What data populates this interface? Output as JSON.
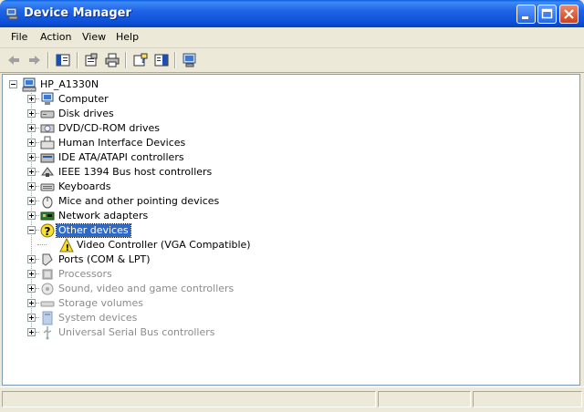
{
  "window": {
    "title": "Device Manager"
  },
  "menu": [
    "File",
    "Action",
    "View",
    "Help"
  ],
  "toolbar": [
    "back-icon",
    "forward-icon",
    "up-icon",
    "properties-icon",
    "print-icon",
    "help-icon",
    "console-tree-icon",
    "scan-hardware-icon"
  ],
  "tree": {
    "root": "HP_A1330N",
    "categories": [
      {
        "label": "Computer",
        "icon": "computer-icon",
        "expanded": false,
        "dim": false
      },
      {
        "label": "Disk drives",
        "icon": "disk-drive-icon",
        "expanded": false,
        "dim": false
      },
      {
        "label": "DVD/CD-ROM drives",
        "icon": "cdrom-icon",
        "expanded": false,
        "dim": false
      },
      {
        "label": "Human Interface Devices",
        "icon": "hid-icon",
        "expanded": false,
        "dim": false
      },
      {
        "label": "IDE ATA/ATAPI controllers",
        "icon": "ide-controller-icon",
        "expanded": false,
        "dim": false
      },
      {
        "label": "IEEE 1394 Bus host controllers",
        "icon": "ieee1394-icon",
        "expanded": false,
        "dim": false
      },
      {
        "label": "Keyboards",
        "icon": "keyboard-icon",
        "expanded": false,
        "dim": false
      },
      {
        "label": "Mice and other pointing devices",
        "icon": "mouse-icon",
        "expanded": false,
        "dim": false
      },
      {
        "label": "Network adapters",
        "icon": "network-adapter-icon",
        "expanded": false,
        "dim": false
      },
      {
        "label": "Other devices",
        "icon": "unknown-device-icon",
        "expanded": true,
        "dim": false,
        "selected": true,
        "children": [
          {
            "label": "Video Controller (VGA Compatible)",
            "icon": "warning-device-icon"
          }
        ]
      },
      {
        "label": "Ports (COM & LPT)",
        "icon": "port-icon",
        "expanded": false,
        "dim": false
      },
      {
        "label": "Processors",
        "icon": "processor-icon",
        "expanded": false,
        "dim": true
      },
      {
        "label": "Sound, video and game controllers",
        "icon": "sound-icon",
        "expanded": false,
        "dim": true
      },
      {
        "label": "Storage volumes",
        "icon": "storage-volume-icon",
        "expanded": false,
        "dim": true
      },
      {
        "label": "System devices",
        "icon": "system-device-icon",
        "expanded": false,
        "dim": true
      },
      {
        "label": "Universal Serial Bus controllers",
        "icon": "usb-icon",
        "expanded": false,
        "dim": true
      }
    ]
  },
  "colors": {
    "titlebar": "#0a4fd6",
    "selection": "#316ac5",
    "chrome": "#ece9d8"
  }
}
